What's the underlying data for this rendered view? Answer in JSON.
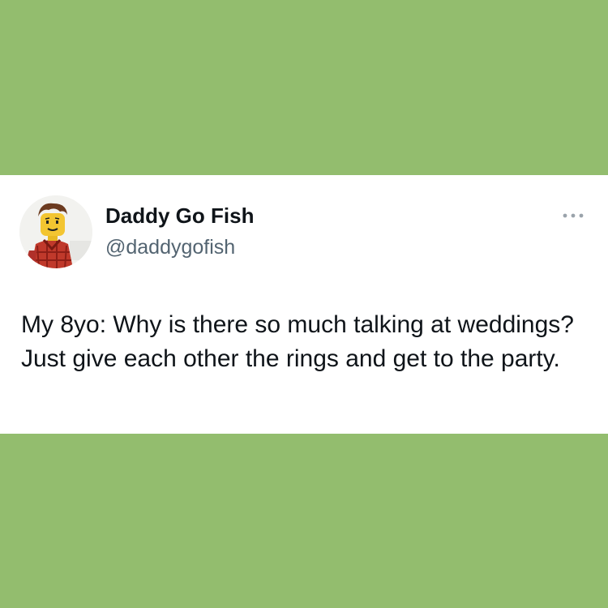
{
  "colors": {
    "page_background": "#93bd6e",
    "card_background": "#ffffff",
    "text_primary": "#0f1419",
    "text_secondary": "#536471"
  },
  "tweet": {
    "author": {
      "display_name": "Daddy Go Fish",
      "handle": "@daddygofish",
      "avatar_icon": "lego-minifigure-avatar"
    },
    "more_icon": "more-options-icon",
    "text": "My 8yo: Why is there so much talking at weddings? Just give each other the rings and get to the party."
  }
}
